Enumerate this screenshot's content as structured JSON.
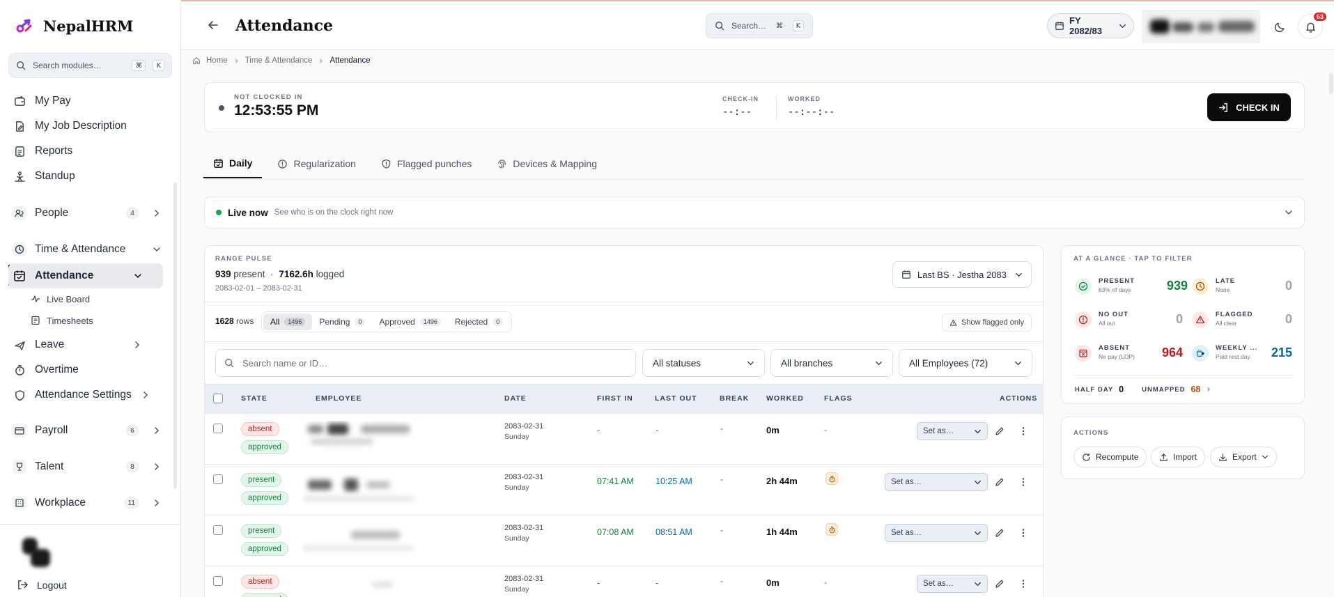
{
  "brand": {
    "name": "NepalHRM"
  },
  "sidebar": {
    "search_placeholder": "Search modules…",
    "kbd_cmd": "⌘",
    "kbd_k": "K",
    "items": [
      {
        "label": "My Pay"
      },
      {
        "label": "My Job Description"
      },
      {
        "label": "Reports"
      },
      {
        "label": "Standup"
      },
      {
        "label": "People",
        "badge": "4"
      },
      {
        "label": "Time & Attendance"
      },
      {
        "label": "Attendance"
      },
      {
        "label": "Live Board"
      },
      {
        "label": "Timesheets"
      },
      {
        "label": "Leave"
      },
      {
        "label": "Overtime"
      },
      {
        "label": "Attendance Settings"
      },
      {
        "label": "Payroll",
        "badge": "6"
      },
      {
        "label": "Talent",
        "badge": "8"
      },
      {
        "label": "Workplace",
        "badge": "11"
      }
    ],
    "logout": "Logout"
  },
  "header": {
    "title": "Attendance",
    "search_placeholder": "Search…",
    "kbd_cmd": "⌘",
    "kbd_k": "K",
    "fiscal_year": "FY 2082/83",
    "notifications": "63"
  },
  "breadcrumb": [
    "Home",
    "Time & Attendance",
    "Attendance"
  ],
  "clock": {
    "status": "NOT CLOCKED IN",
    "time": "12:53:55 PM",
    "checkin_label": "CHECK-IN",
    "checkin_value": "--:--",
    "worked_label": "WORKED",
    "worked_value": "--:--:--",
    "button": "CHECK IN"
  },
  "tabs": [
    "Daily",
    "Regularization",
    "Flagged punches",
    "Devices & Mapping"
  ],
  "live": {
    "title": "Live now",
    "subtitle": "See who is on the clock right now"
  },
  "range_pulse": {
    "label": "RANGE PULSE",
    "present": "939",
    "present_word": "present",
    "sep": "·",
    "logged": "7162.6h",
    "logged_word": "logged",
    "range": "2083-02-01 – 2083-02-31",
    "selector": "Last BS · Jestha 2083"
  },
  "filters": {
    "rows_count": "1628",
    "rows_word": "rows",
    "chips": [
      {
        "label": "All",
        "count": "1496"
      },
      {
        "label": "Pending",
        "count": "0"
      },
      {
        "label": "Approved",
        "count": "1496"
      },
      {
        "label": "Rejected",
        "count": "0"
      }
    ],
    "show_flagged": "Show flagged only",
    "search_placeholder": "Search name or ID…",
    "status_select": "All statuses",
    "branch_select": "All branches",
    "employee_select": "All Employees (72)"
  },
  "table": {
    "headers": {
      "state": "STATE",
      "employee": "EMPLOYEE",
      "date": "DATE",
      "first_in": "FIRST IN",
      "last_out": "LAST OUT",
      "break": "BREAK",
      "worked": "WORKED",
      "flags": "FLAGS",
      "actions": "ACTIONS"
    },
    "set_as": "Set as…",
    "rows": [
      {
        "state": "absent",
        "approval": "approved",
        "date": "2083-02-31",
        "day": "Sunday",
        "first_in": "-",
        "last_out": "-",
        "break": "-",
        "worked": "0m",
        "flags": "-"
      },
      {
        "state": "present",
        "approval": "approved",
        "date": "2083-02-31",
        "day": "Sunday",
        "first_in": "07:41 AM",
        "last_out": "10:25 AM",
        "break": "-",
        "worked": "2h 44m",
        "flag_icon": "stopwatch-icon"
      },
      {
        "state": "present",
        "approval": "approved",
        "date": "2083-02-31",
        "day": "Sunday",
        "first_in": "07:08 AM",
        "last_out": "08:51 AM",
        "break": "-",
        "worked": "1h 44m",
        "flag_icon": "stopwatch-icon"
      },
      {
        "state": "absent",
        "approval": "approved",
        "date": "2083-02-31",
        "day": "Sunday",
        "first_in": "-",
        "last_out": "-",
        "break": "-",
        "worked": "0m",
        "flags": "-"
      }
    ]
  },
  "glance": {
    "title": "AT A GLANCE · TAP TO FILTER",
    "stats": {
      "present": {
        "label": "PRESENT",
        "sub": "63% of days",
        "value": "939",
        "color": "#15803d"
      },
      "late": {
        "label": "LATE",
        "sub": "None",
        "value": "0",
        "color": "#9ca3af"
      },
      "no_out": {
        "label": "NO OUT",
        "sub": "All out",
        "value": "0",
        "color": "#9ca3af"
      },
      "flagged": {
        "label": "FLAGGED",
        "sub": "All clear",
        "value": "0",
        "color": "#9ca3af"
      },
      "absent": {
        "label": "ABSENT",
        "sub": "No pay (LOP)",
        "value": "964",
        "color": "#b91c1c"
      },
      "weekly": {
        "label": "WEEKLY ...",
        "sub": "Paid rest day",
        "value": "215",
        "color": "#0369a1"
      }
    },
    "half_day_label": "HALF DAY",
    "half_day_value": "0",
    "unmapped_label": "UNMAPPED",
    "unmapped_value": "68"
  },
  "actions": {
    "title": "ACTIONS",
    "recompute": "Recompute",
    "import": "Import",
    "export": "Export"
  }
}
